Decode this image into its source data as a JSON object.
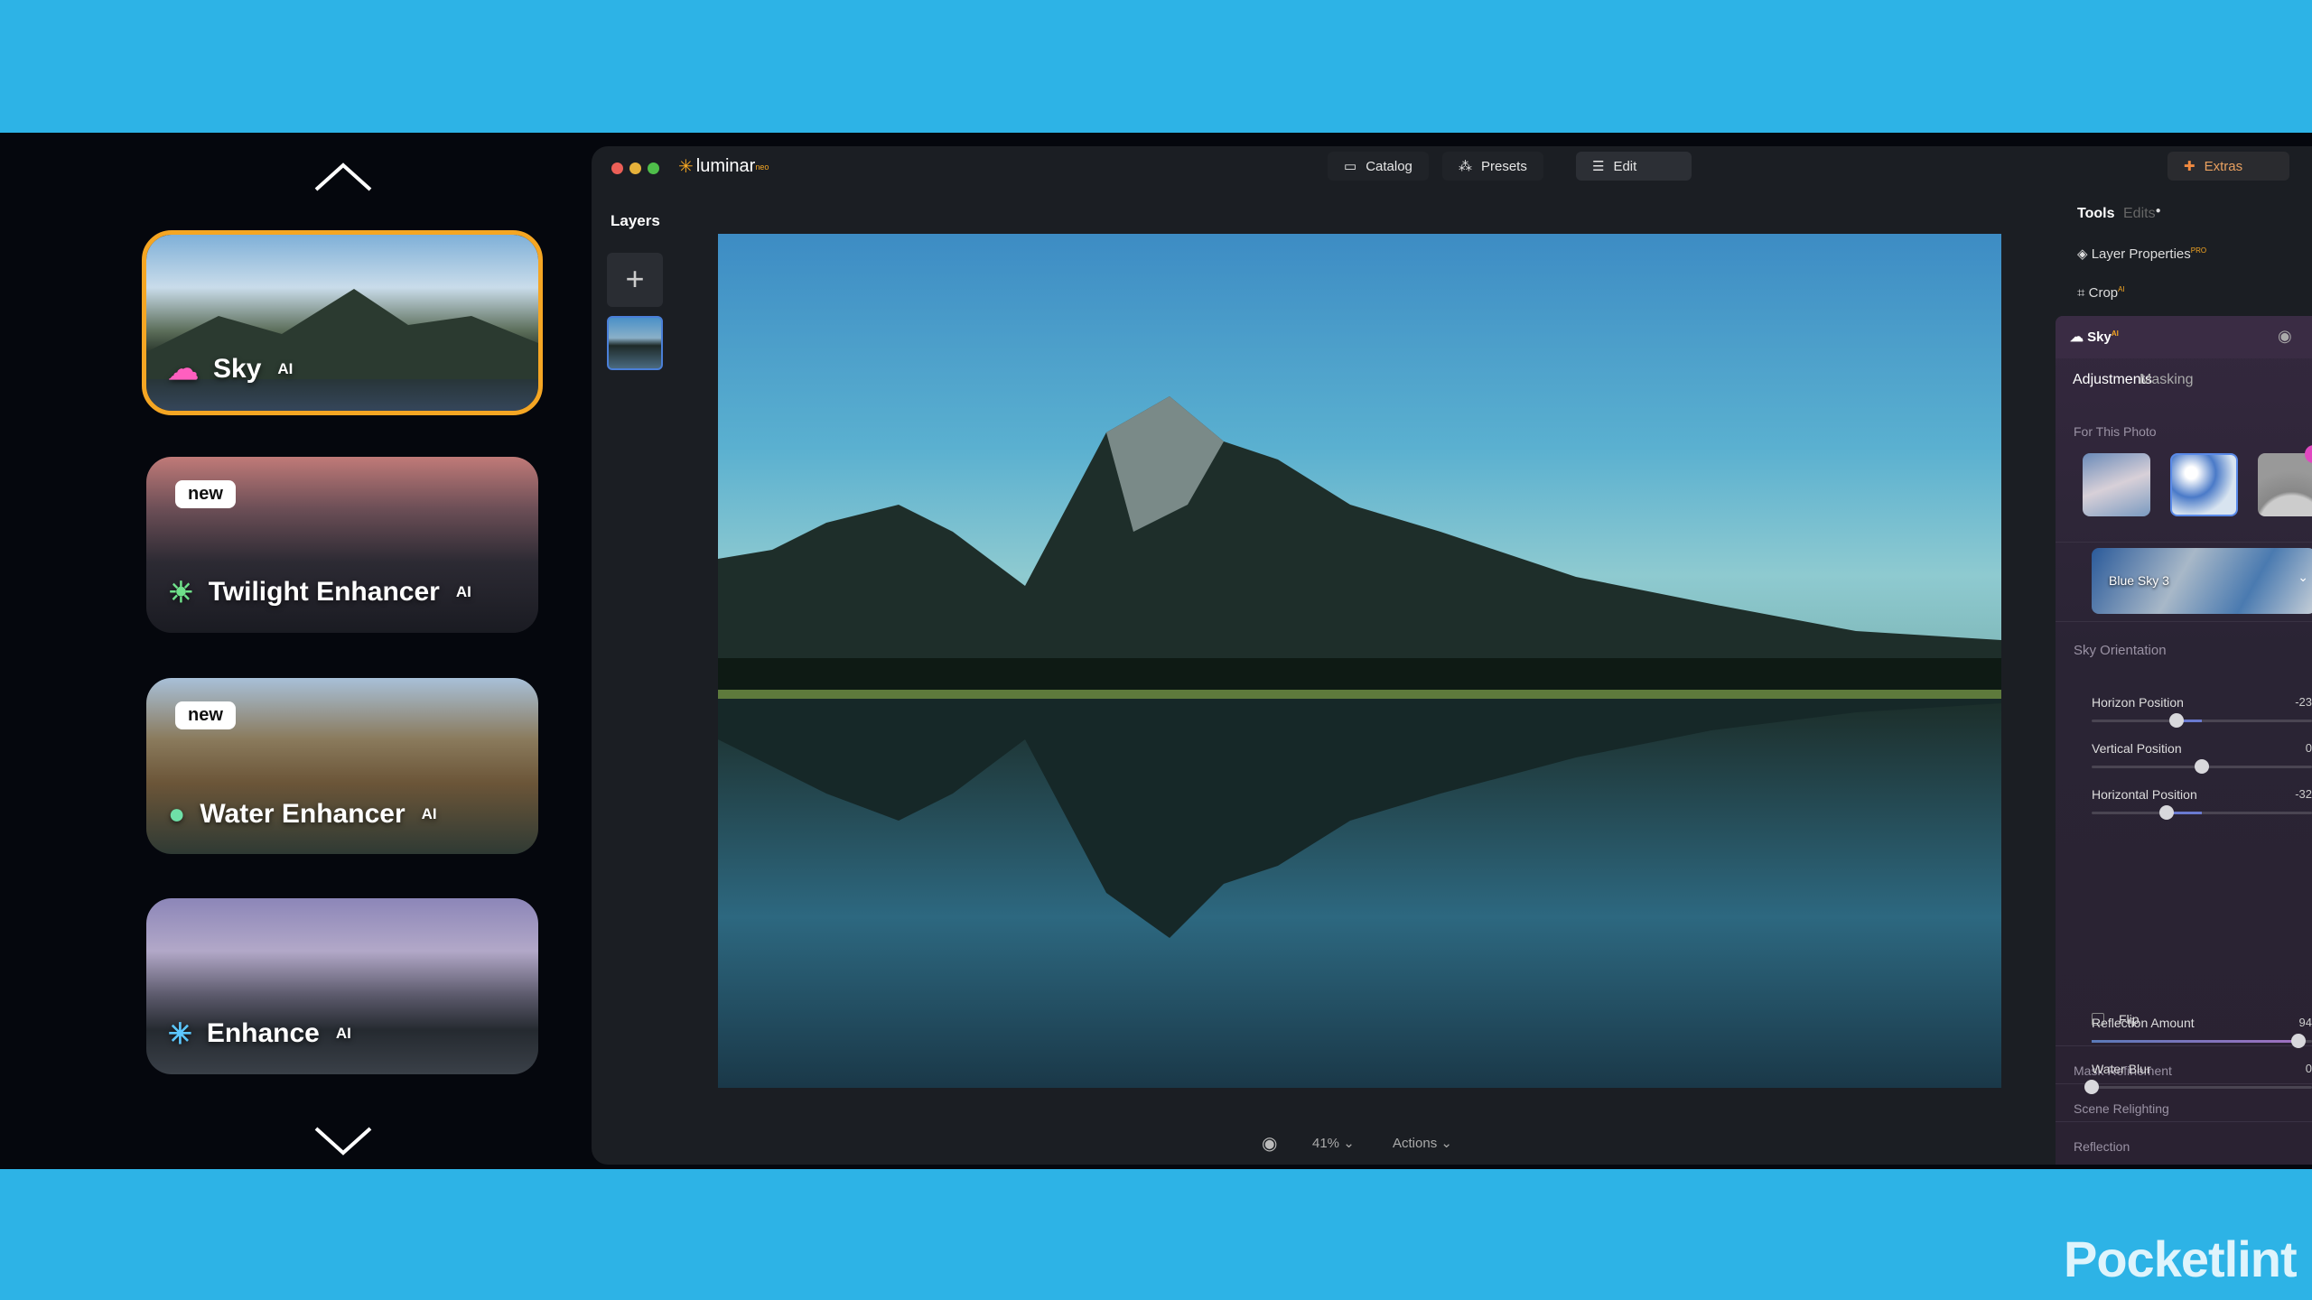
{
  "left_carousel": {
    "cards": [
      {
        "title": "Sky",
        "suffix": "AI",
        "badge": "",
        "icon": "cloud-icon",
        "icon_color": "#ff5fbf",
        "selected": true
      },
      {
        "title": "Twilight Enhancer",
        "suffix": "AI",
        "badge": "new",
        "icon": "sunrise-icon",
        "icon_color": "#6fe08a",
        "selected": false
      },
      {
        "title": "Water Enhancer",
        "suffix": "AI",
        "badge": "new",
        "icon": "drop-icon",
        "icon_color": "#6fe0a8",
        "selected": false
      },
      {
        "title": "Enhance",
        "suffix": "AI",
        "badge": "",
        "icon": "sparkle-icon",
        "icon_color": "#5cc8ff",
        "selected": false
      }
    ]
  },
  "app": {
    "logo": "luminar",
    "logo_suffix": "neo",
    "tabs": [
      {
        "label": "Catalog",
        "icon": "folder-icon"
      },
      {
        "label": "Presets",
        "icon": "magic-wand-icon"
      },
      {
        "label": "Edit",
        "icon": "sliders-icon",
        "active": true
      }
    ],
    "extras_label": "Extras",
    "layers_title": "Layers",
    "bottom": {
      "zoom": "41%",
      "actions": "Actions"
    }
  },
  "panel": {
    "tabs": [
      "Tools",
      "Edits"
    ],
    "layer_properties": "Layer Properties",
    "layer_properties_badge": "PRO",
    "crop": "Crop",
    "crop_badge": "AI",
    "sky_title": "Sky",
    "sky_badge": "AI",
    "sub_tabs": [
      "Adjustments",
      "Masking"
    ],
    "for_this_photo": "For This Photo",
    "sky_select": "Blue Sky 3",
    "sky_orientation": "Sky Orientation",
    "sliders": [
      {
        "label": "Horizon Position",
        "value": "-23",
        "num": -23,
        "min": -100,
        "max": 100
      },
      {
        "label": "Vertical Position",
        "value": "0",
        "num": 0,
        "min": -100,
        "max": 100
      },
      {
        "label": "Horizontal Position",
        "value": "-32",
        "num": -32,
        "min": -100,
        "max": 100
      }
    ],
    "flip": "Flip",
    "flip_checked": false,
    "sections": [
      "Mask Refinement",
      "Scene Relighting",
      "Reflection"
    ],
    "reflection_sliders": [
      {
        "label": "Reflection Amount",
        "value": "94",
        "num": 94,
        "min": 0,
        "max": 100
      },
      {
        "label": "Water Blur",
        "value": "0",
        "num": 0,
        "min": 0,
        "max": 100
      }
    ]
  },
  "watermark": "Pocketlint",
  "colors": {
    "frame_blue": "#2db3e6",
    "accent_orange": "#f5a623",
    "panel_purple": "#2c2436"
  }
}
